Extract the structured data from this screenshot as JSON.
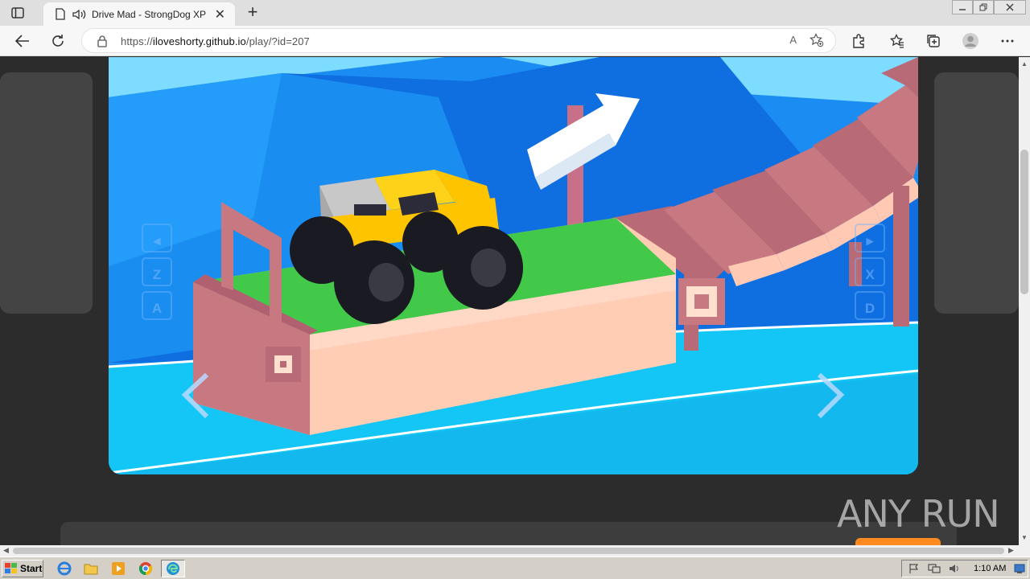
{
  "browser": {
    "tab_title": "Drive Mad - StrongDog XP",
    "url_prefix": "https://",
    "url_host": "iloveshorty.github.io",
    "url_path": "/play/?id=207",
    "read_aloud": "A",
    "new_tab": "+",
    "tab_close": "✕"
  },
  "game": {
    "left_keys": [
      "◂",
      "Z",
      "A"
    ],
    "right_keys": [
      "▸",
      "X",
      "D"
    ]
  },
  "watermark": {
    "text": "ANY RUN"
  },
  "taskbar": {
    "start_label": "Start",
    "clock": "1:10 AM"
  }
}
